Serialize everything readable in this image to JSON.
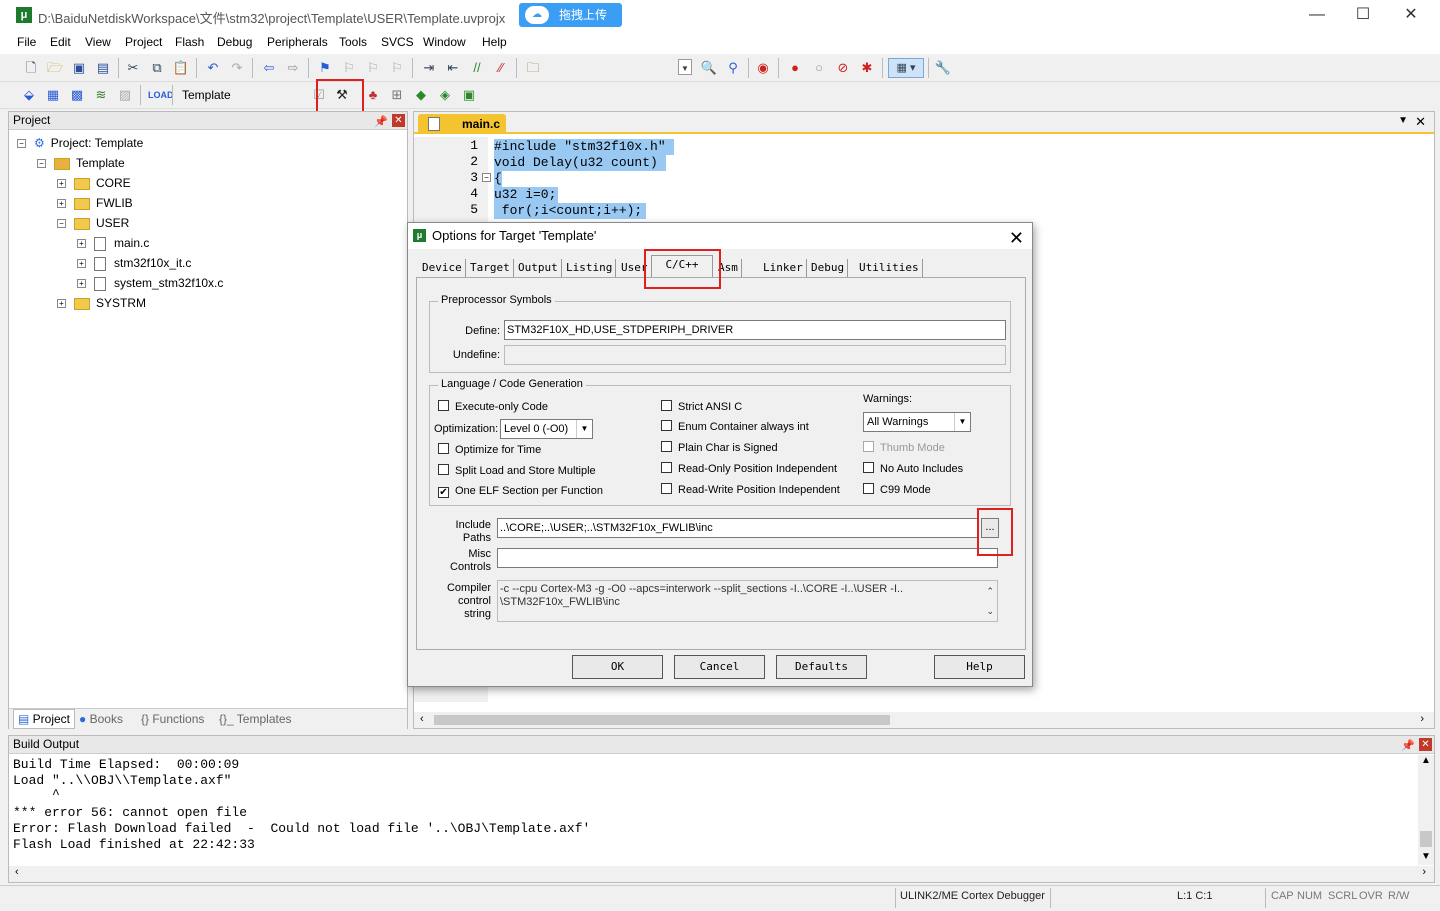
{
  "window": {
    "title": "D:\\BaiduNetdiskWorkspace\\文件\\stm32\\project\\Template\\USER\\Template.uvprojx",
    "upload_label": "拖拽上传"
  },
  "menu": [
    "File",
    "Edit",
    "View",
    "Project",
    "Flash",
    "Debug",
    "Peripherals",
    "Tools",
    "SVCS",
    "Window",
    "Help"
  ],
  "toolbar2": {
    "target_name": "Template"
  },
  "project_panel": {
    "header": "Project",
    "root": "Project: Template",
    "group": "Template",
    "folders": [
      "CORE",
      "FWLIB",
      "USER"
    ],
    "files": [
      "main.c",
      "stm32f10x_it.c",
      "system_stm32f10x.c"
    ],
    "last_folder": "SYSTRM",
    "tabs": [
      "Project",
      "Books",
      "{} Functions",
      "{}_ Templates"
    ]
  },
  "editor": {
    "tab": "main.c",
    "line_numbers": [
      "1",
      "2",
      "3",
      "4",
      "5"
    ],
    "lines": [
      "#include \"stm32f10x.h\"",
      "void Delay(u32 count)",
      "{",
      "u32 i=0;",
      " for(;i<count;i++);"
    ]
  },
  "dialog": {
    "title": "Options for Target 'Template'",
    "tabs": [
      "Device",
      "Target",
      "Output",
      "Listing",
      "User",
      "C/C++",
      "Asm",
      "Linker",
      "Debug",
      "Utilities"
    ],
    "preprocessor": {
      "group": "Preprocessor Symbols",
      "define_label": "Define:",
      "define_value": "STM32F10X_HD,USE_STDPERIPH_DRIVER",
      "undefine_label": "Undefine:"
    },
    "language": {
      "group": "Language / Code Generation",
      "execute_only": "Execute-only Code",
      "optimization_label": "Optimization:",
      "optimization_value": "Level 0 (-O0)",
      "optimize_time": "Optimize for Time",
      "split_load": "Split Load and Store Multiple",
      "one_elf": "One ELF Section per Function",
      "strict_ansi": "Strict ANSI C",
      "enum_container": "Enum Container always int",
      "plain_char": "Plain Char is Signed",
      "ro_pos": "Read-Only Position Independent",
      "rw_pos": "Read-Write Position Independent",
      "warnings_label": "Warnings:",
      "warnings_value": "All Warnings",
      "thumb_mode": "Thumb Mode",
      "no_auto_includes": "No Auto Includes",
      "c99_mode": "C99 Mode"
    },
    "include_label_1": "Include",
    "include_label_2": "Paths",
    "include_value": "..\\CORE;..\\USER;..\\STM32F10x_FWLIB\\inc",
    "browse_label": "...",
    "misc_label_1": "Misc",
    "misc_label_2": "Controls",
    "compiler_label_1": "Compiler",
    "compiler_label_2": "control",
    "compiler_label_3": "string",
    "compiler_line_1": "-c --cpu Cortex-M3 -g -O0 --apcs=interwork --split_sections -I..\\CORE -I..\\USER -I..",
    "compiler_line_2": "\\STM32F10x_FWLIB\\inc",
    "buttons": [
      "OK",
      "Cancel",
      "Defaults",
      "Help"
    ]
  },
  "build_output": {
    "header": "Build Output",
    "lines": [
      "Build Time Elapsed:  00:00:09",
      "Load \"..\\\\OBJ\\\\Template.axf\"",
      "     ^",
      "*** error 56: cannot open file",
      "Error: Flash Download failed  -  Could not load file '..\\OBJ\\Template.axf'",
      "Flash Load finished at 22:42:33"
    ]
  },
  "status": {
    "debugger": "ULINK2/ME Cortex Debugger",
    "position": "L:1 C:1",
    "caps": "CAP",
    "num": "NUM",
    "scrl": "SCRL",
    "ovr": "OVR",
    "rw": "R/W"
  }
}
